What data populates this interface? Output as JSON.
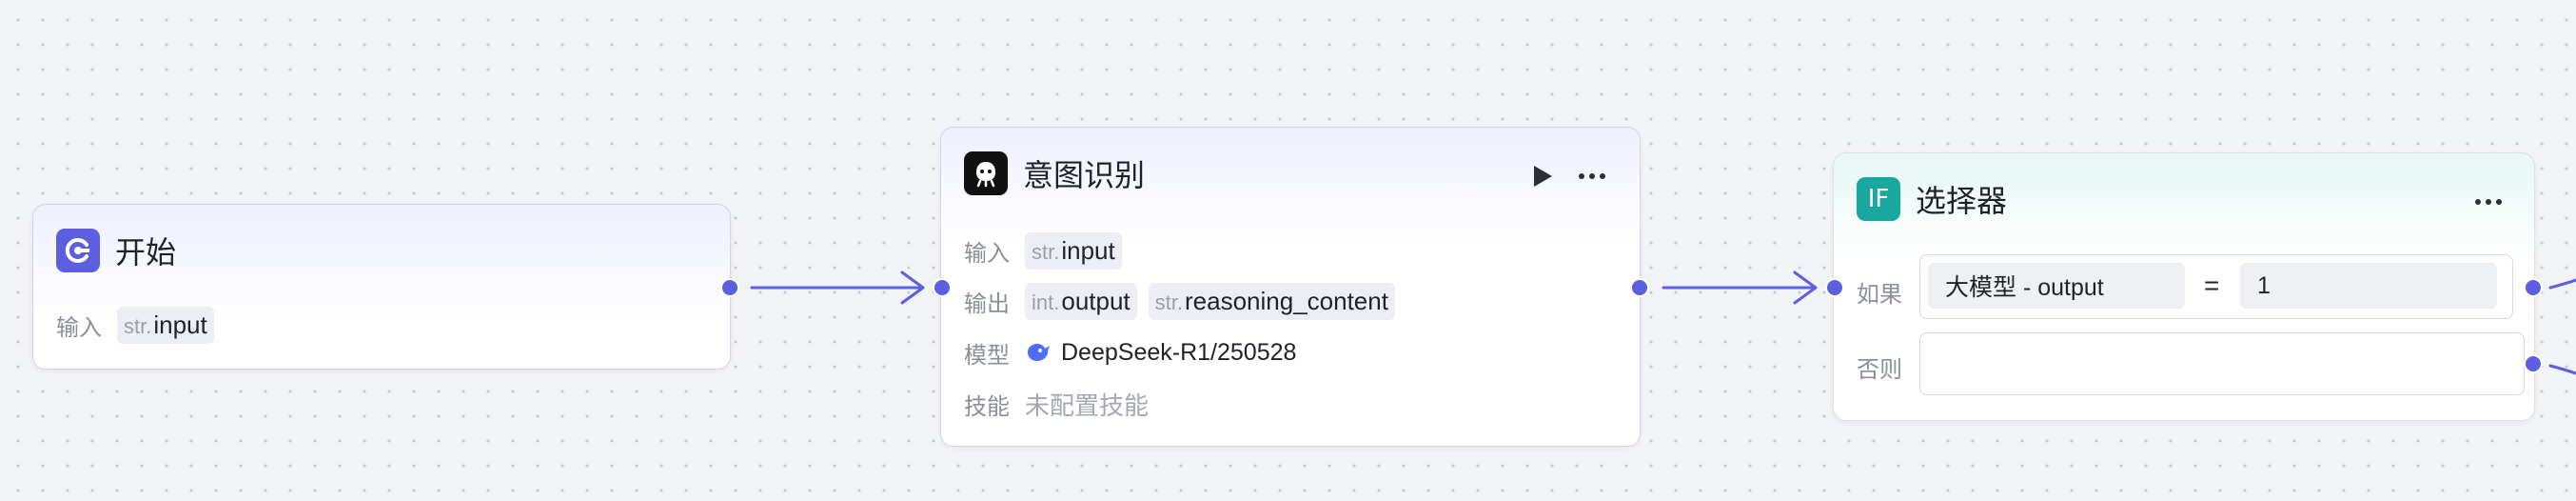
{
  "colors": {
    "accent": "#5b5fe0",
    "start_icon_bg": "#5b5fe0",
    "intent_icon_bg": "#111111",
    "selector_icon_bg": "#1aa7a0"
  },
  "start_node": {
    "title": "开始",
    "icon": "start-icon",
    "input_label": "输入",
    "inputs": [
      {
        "type": "str.",
        "name": "input"
      }
    ]
  },
  "intent_node": {
    "title": "意图识别",
    "icon": "intent-icon",
    "input_label": "输入",
    "inputs": [
      {
        "type": "str.",
        "name": "input"
      }
    ],
    "output_label": "输出",
    "outputs": [
      {
        "type": "int.",
        "name": "output"
      },
      {
        "type": "str.",
        "name": "reasoning_content"
      }
    ],
    "model_label": "模型",
    "model": "DeepSeek-R1/250528",
    "skills_label": "技能",
    "skills_value": "未配置技能"
  },
  "selector_node": {
    "title": "选择器",
    "icon_text": "IF",
    "if_label": "如果",
    "condition": {
      "left": "大模型  -  output",
      "operator": "=",
      "right": "1"
    },
    "else_label": "否则"
  }
}
